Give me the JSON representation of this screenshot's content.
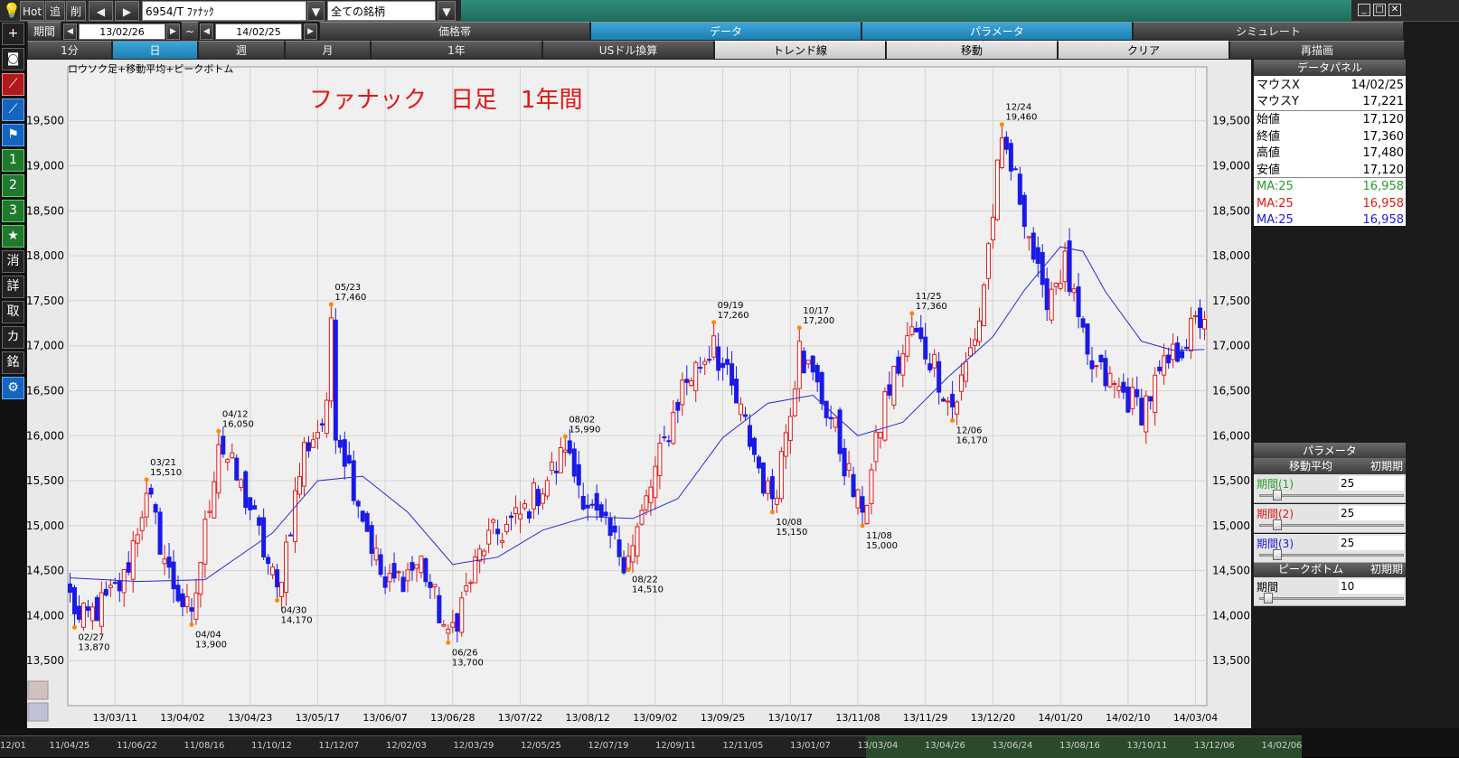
{
  "toolbar": {
    "hot": "Hot",
    "add": "追",
    "del": "削",
    "symbol": "6954/T ﾌｧﾅｯｸ",
    "universe": "全ての銘柄"
  },
  "period_row": {
    "label": "期間",
    "start": "13/02/26",
    "sep": "~",
    "end": "14/02/25",
    "tabs": [
      "価格帯",
      "データ",
      "パラメータ",
      "シミュレート"
    ]
  },
  "interval_row": {
    "items": [
      "1分",
      "日",
      "週",
      "月",
      "1年",
      "USドル換算",
      "トレンド線",
      "移動",
      "クリア",
      "再描画"
    ],
    "selected_index": 1
  },
  "left_toolbar": {
    "buttons": [
      "plus-icon",
      "camera-icon",
      "line-chart-icon",
      "line-chart-icon-2",
      "flag-icon",
      "1",
      "2",
      "3",
      "star-icon",
      "消",
      "詳",
      "取",
      "カ",
      "銘",
      "gear-icon"
    ]
  },
  "chart": {
    "subtitle": "ロウソク足+移動平均+ピークボトム",
    "title": "ファナック　日足　1年間",
    "colors": {
      "up": "#e01818",
      "down": "#1a1ae8",
      "ma": "#2a2ad0",
      "peak": "#ff8800",
      "bg": "#e9e9e9",
      "title": "#e01818"
    }
  },
  "chart_data": {
    "type": "candlestick",
    "title": "ファナック　日足　1年間",
    "subtitle": "ロウソク足+移動平均+ピークボトム",
    "y_ticks": [
      13500,
      14000,
      14500,
      15000,
      15500,
      16000,
      16500,
      17000,
      17500,
      18000,
      18500,
      19000,
      19500
    ],
    "y_tick_labels": [
      "13,500",
      "14,000",
      "14,500",
      "15,000",
      "15,500",
      "16,000",
      "16,500",
      "17,000",
      "17,500",
      "18,000",
      "18,500",
      "19,000",
      "19,500"
    ],
    "ylim": [
      13000,
      20100
    ],
    "x_tick_labels": [
      "13/03/11",
      "13/04/02",
      "13/04/23",
      "13/05/17",
      "13/06/07",
      "13/06/28",
      "13/07/22",
      "13/08/12",
      "13/09/02",
      "13/09/25",
      "13/10/17",
      "13/11/08",
      "13/11/29",
      "13/12/20",
      "14/01/20",
      "14/02/10",
      "14/03/04"
    ],
    "x_tick_index": [
      10,
      25,
      40,
      55,
      70,
      85,
      100,
      115,
      130,
      145,
      160,
      175,
      190,
      205,
      220,
      235,
      250
    ],
    "grid": true,
    "peaks_bottoms": [
      {
        "date": "02/27",
        "value": 13870,
        "label_value": "13,870",
        "index": 1,
        "kind": "bottom"
      },
      {
        "date": "03/21",
        "value": 15510,
        "label_value": "15,510",
        "index": 17,
        "kind": "peak"
      },
      {
        "date": "04/04",
        "value": 13900,
        "label_value": "13,900",
        "index": 27,
        "kind": "bottom"
      },
      {
        "date": "04/12",
        "value": 16050,
        "label_value": "16,050",
        "index": 33,
        "kind": "peak"
      },
      {
        "date": "04/30",
        "value": 14170,
        "label_value": "14,170",
        "index": 46,
        "kind": "bottom"
      },
      {
        "date": "05/23",
        "value": 17460,
        "label_value": "17,460",
        "index": 58,
        "kind": "peak"
      },
      {
        "date": "06/26",
        "value": 13700,
        "label_value": "13,700",
        "index": 84,
        "kind": "bottom"
      },
      {
        "date": "08/02",
        "value": 15990,
        "label_value": "15,990",
        "index": 110,
        "kind": "peak"
      },
      {
        "date": "08/22",
        "value": 14510,
        "label_value": "14,510",
        "index": 124,
        "kind": "bottom"
      },
      {
        "date": "09/19",
        "value": 17260,
        "label_value": "17,260",
        "index": 143,
        "kind": "peak"
      },
      {
        "date": "10/08",
        "value": 15150,
        "label_value": "15,150",
        "index": 156,
        "kind": "bottom"
      },
      {
        "date": "10/17",
        "value": 17200,
        "label_value": "17,200",
        "index": 162,
        "kind": "peak"
      },
      {
        "date": "11/08",
        "value": 15000,
        "label_value": "15,000",
        "index": 176,
        "kind": "bottom"
      },
      {
        "date": "11/25",
        "value": 17360,
        "label_value": "17,360",
        "index": 187,
        "kind": "peak"
      },
      {
        "date": "12/06",
        "value": 16170,
        "label_value": "16,170",
        "index": 196,
        "kind": "bottom"
      },
      {
        "date": "12/24",
        "value": 19460,
        "label_value": "19,460",
        "index": 207,
        "kind": "peak"
      }
    ],
    "ma_series": {
      "name": "MA:25",
      "x": [
        0,
        15,
        30,
        45,
        55,
        65,
        75,
        85,
        95,
        105,
        115,
        125,
        135,
        145,
        155,
        165,
        175,
        185,
        195,
        205,
        212,
        220,
        225,
        230,
        238,
        245,
        252
      ],
      "values": [
        14420,
        14380,
        14400,
        14920,
        15500,
        15550,
        15150,
        14570,
        14650,
        14950,
        15100,
        15080,
        15300,
        15980,
        16360,
        16450,
        16000,
        16150,
        16650,
        17100,
        17620,
        18100,
        18050,
        17600,
        17050,
        16950,
        16958
      ]
    },
    "n_bars": 253,
    "ohlc_anchors": [
      {
        "i": 0,
        "c": 14200
      },
      {
        "i": 1,
        "c": 13870
      },
      {
        "i": 8,
        "c": 14150
      },
      {
        "i": 12,
        "c": 14400
      },
      {
        "i": 17,
        "c": 15400
      },
      {
        "i": 22,
        "c": 14450
      },
      {
        "i": 27,
        "c": 13950
      },
      {
        "i": 33,
        "c": 15950
      },
      {
        "i": 40,
        "c": 15200
      },
      {
        "i": 46,
        "c": 14250
      },
      {
        "i": 52,
        "c": 15850
      },
      {
        "i": 58,
        "c": 16300
      },
      {
        "i": 64,
        "c": 15300
      },
      {
        "i": 70,
        "c": 14300
      },
      {
        "i": 78,
        "c": 14600
      },
      {
        "i": 84,
        "c": 13750
      },
      {
        "i": 92,
        "c": 14800
      },
      {
        "i": 100,
        "c": 15100
      },
      {
        "i": 110,
        "c": 15800
      },
      {
        "i": 117,
        "c": 15050
      },
      {
        "i": 124,
        "c": 14600
      },
      {
        "i": 130,
        "c": 15600
      },
      {
        "i": 136,
        "c": 16550
      },
      {
        "i": 143,
        "c": 17000
      },
      {
        "i": 150,
        "c": 16100
      },
      {
        "i": 156,
        "c": 15200
      },
      {
        "i": 162,
        "c": 16950
      },
      {
        "i": 169,
        "c": 16200
      },
      {
        "i": 176,
        "c": 15050
      },
      {
        "i": 181,
        "c": 16400
      },
      {
        "i": 187,
        "c": 17150
      },
      {
        "i": 192,
        "c": 16800
      },
      {
        "i": 196,
        "c": 16250
      },
      {
        "i": 202,
        "c": 17300
      },
      {
        "i": 207,
        "c": 19300
      },
      {
        "i": 212,
        "c": 18500
      },
      {
        "i": 216,
        "c": 17500
      },
      {
        "i": 221,
        "c": 17900
      },
      {
        "i": 226,
        "c": 16800
      },
      {
        "i": 233,
        "c": 16500
      },
      {
        "i": 238,
        "c": 16300
      },
      {
        "i": 244,
        "c": 16800
      },
      {
        "i": 252,
        "c": 17360
      }
    ],
    "legend_series": [
      {
        "name": "MA:25",
        "value": 16958,
        "color": "#2a9d2a"
      },
      {
        "name": "MA:25",
        "value": 16958,
        "color": "#e01818"
      },
      {
        "name": "MA:25",
        "value": 16958,
        "color": "#1a1ae8"
      }
    ]
  },
  "data_panel": {
    "title": "データパネル",
    "rows": [
      {
        "label": "マウスX",
        "value": "14/02/25"
      },
      {
        "label": "マウスY",
        "value": "17,221"
      },
      {
        "label": "始値",
        "value": "17,120"
      },
      {
        "label": "終値",
        "value": "17,360"
      },
      {
        "label": "高値",
        "value": "17,480"
      },
      {
        "label": "安値",
        "value": "17,120"
      }
    ],
    "ma_rows": [
      {
        "label": "MA:25",
        "value": "16,958",
        "color": "#2a9d2a"
      },
      {
        "label": "MA:25",
        "value": "16,958",
        "color": "#e01818"
      },
      {
        "label": "MA:25",
        "value": "16,958",
        "color": "#1a1ae8"
      }
    ]
  },
  "param_panel": {
    "title": "パラメータ",
    "ma_section": "移動平均",
    "reset": "初期期",
    "params": [
      {
        "label": "期間(1)",
        "value": "25",
        "color": "#2a9d2a",
        "level": 0.1
      },
      {
        "label": "期間(2)",
        "value": "25",
        "color": "#e01818",
        "level": 0.1
      },
      {
        "label": "期間(3)",
        "value": "25",
        "color": "#1a1ae8",
        "level": 0.1
      }
    ],
    "pb_section": "ピークボトム",
    "pb_reset": "初期期",
    "pb_param": {
      "label": "期間",
      "value": "10",
      "level": 0.03
    }
  },
  "bottom_dates": [
    "12/01",
    "11/04/25",
    "11/06/22",
    "11/08/16",
    "11/10/12",
    "11/12/07",
    "12/02/03",
    "12/03/29",
    "12/05/25",
    "12/07/19",
    "12/09/11",
    "12/11/05",
    "13/01/07",
    "13/03/04",
    "13/04/26",
    "13/06/24",
    "13/08/16",
    "13/10/11",
    "13/12/06",
    "14/02/06"
  ]
}
